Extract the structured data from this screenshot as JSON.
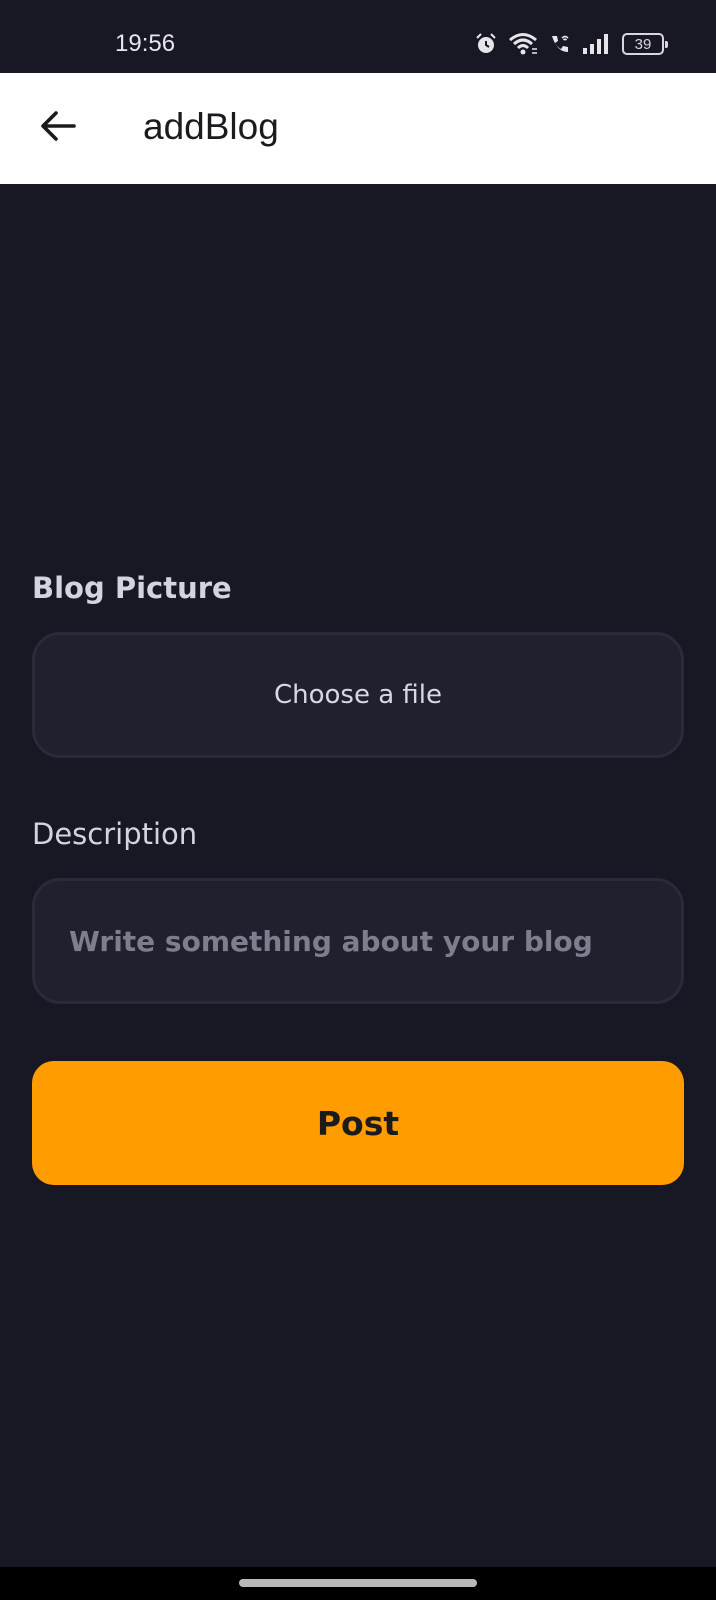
{
  "status_bar": {
    "time": "19:56",
    "battery_level": "39",
    "icons": [
      "alarm-icon",
      "wifi-icon",
      "wifi-call-icon",
      "signal-icon",
      "battery-icon"
    ]
  },
  "app_bar": {
    "title": "addBlog",
    "back_icon": "arrow-left-icon"
  },
  "form": {
    "picture_label": "Blog Picture",
    "choose_file_label": "Choose a file",
    "description_label": "Description",
    "description_placeholder": "Write something about your blog",
    "description_value": "",
    "post_label": "Post"
  },
  "colors": {
    "background": "#181824",
    "field_background": "#20202e",
    "accent": "#ff9c00",
    "app_bar": "#ffffff"
  }
}
